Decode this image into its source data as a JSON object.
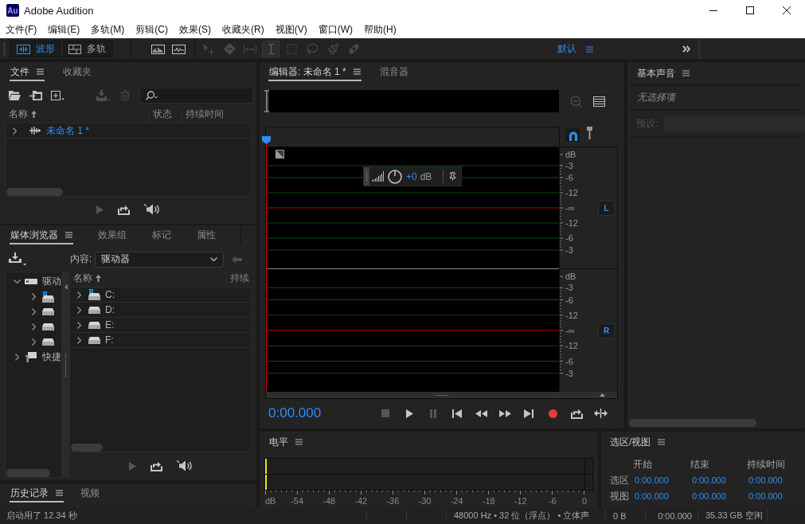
{
  "window": {
    "app_icon": "Au",
    "title": "Adobe Audition"
  },
  "menu": [
    "文件(F)",
    "编辑(E)",
    "多轨(M)",
    "剪辑(C)",
    "效果(S)",
    "收藏夹(R)",
    "视图(V)",
    "窗口(W)",
    "帮助(H)"
  ],
  "toolbar": {
    "views": [
      {
        "kind": "waveform",
        "label": "波形",
        "selected": true
      },
      {
        "kind": "multitrack",
        "label": "多轨",
        "selected": false
      }
    ],
    "displays": [
      {
        "kind": "spectral"
      },
      {
        "kind": "pitch"
      }
    ],
    "tools": [
      {
        "kind": "move",
        "disabled": true,
        "selected": false
      },
      {
        "kind": "razor",
        "disabled": true,
        "selected": false
      },
      {
        "kind": "slip",
        "disabled": true,
        "selected": false
      },
      {
        "kind": "time",
        "disabled": true,
        "selected": true
      },
      {
        "kind": "marquee",
        "disabled": true,
        "selected": false
      },
      {
        "kind": "lasso",
        "disabled": true,
        "selected": false
      },
      {
        "kind": "brush",
        "disabled": true,
        "selected": false
      },
      {
        "kind": "heal",
        "disabled": true,
        "selected": false
      }
    ],
    "workspace": "默认"
  },
  "files_panel": {
    "tabs": [
      {
        "label": "文件",
        "selected": true
      },
      {
        "label": "收藏夹",
        "selected": false
      }
    ],
    "actions": [
      {
        "kind": "open",
        "disabled": false
      },
      {
        "kind": "import",
        "disabled": false
      },
      {
        "kind": "new",
        "disabled": false
      },
      {
        "kind": "insert",
        "disabled": true
      },
      {
        "kind": "delete",
        "disabled": true
      }
    ],
    "columns": [
      {
        "label": "名称",
        "sorted": true
      },
      {
        "label": "状态",
        "sorted": false
      },
      {
        "label": "持续时间",
        "sorted": false
      }
    ],
    "rows": [
      {
        "name": "未命名 1 *",
        "expanded": false,
        "open": true
      }
    ],
    "playback": [
      {
        "kind": "play",
        "disabled": true
      },
      {
        "kind": "loop",
        "disabled": false
      },
      {
        "kind": "autoplay",
        "disabled": false
      }
    ]
  },
  "media_browser": {
    "tabs": [
      {
        "label": "媒体浏览器",
        "selected": true
      },
      {
        "label": "效果组",
        "selected": false
      },
      {
        "label": "标记",
        "selected": false
      },
      {
        "label": "属性",
        "selected": false
      }
    ],
    "content_label": "内容:",
    "content_value": "驱动器",
    "tree": [
      {
        "kind": "drives",
        "label": "驱动",
        "expanded": true,
        "children": [
          {
            "kind": "system",
            "expanded": false
          },
          {
            "kind": "drive",
            "expanded": false
          },
          {
            "kind": "drive",
            "expanded": false
          },
          {
            "kind": "drive",
            "expanded": false
          }
        ]
      },
      {
        "kind": "shortcuts",
        "label": "快捷",
        "expanded": false
      }
    ],
    "columns": [
      {
        "label": "名称",
        "sorted": true
      },
      {
        "label": "持续",
        "sorted": false
      }
    ],
    "rows": [
      {
        "kind": "system",
        "label": "C:",
        "expanded": false
      },
      {
        "kind": "drive",
        "label": "D:",
        "expanded": false
      },
      {
        "kind": "drive",
        "label": "E:",
        "expanded": false
      },
      {
        "kind": "drive",
        "label": "F:",
        "expanded": false
      }
    ],
    "playback": [
      {
        "kind": "play",
        "disabled": true
      },
      {
        "kind": "loop",
        "disabled": false
      },
      {
        "kind": "autoplay",
        "disabled": false
      }
    ]
  },
  "history_panel": {
    "tabs": [
      {
        "label": "历史记录",
        "selected": true
      },
      {
        "label": "视频",
        "selected": false
      }
    ]
  },
  "editor": {
    "tabs": [
      {
        "label": "编辑器: 未命名 1 *",
        "selected": true
      },
      {
        "label": "混音器",
        "selected": false
      }
    ],
    "snap": true,
    "hud": {
      "value": "+0",
      "unit": "dB"
    },
    "channels": [
      {
        "label": "L",
        "enabled": true,
        "scale": [
          "dB",
          "-3",
          "-6",
          "-12",
          "-∞",
          "-12",
          "-6",
          "-3"
        ]
      },
      {
        "label": "R",
        "enabled": true,
        "scale": [
          "dB",
          "-3",
          "-6",
          "-12",
          "-∞",
          "-12",
          "-6",
          "-3"
        ]
      }
    ],
    "time": "0:00.000",
    "transport": [
      {
        "kind": "stop",
        "disabled": true
      },
      {
        "kind": "play",
        "disabled": false
      },
      {
        "kind": "pause",
        "disabled": true
      },
      {
        "kind": "to_start",
        "disabled": false
      },
      {
        "kind": "rewind",
        "disabled": false
      },
      {
        "kind": "forward",
        "disabled": false
      },
      {
        "kind": "to_end",
        "disabled": false
      },
      {
        "kind": "record",
        "disabled": false
      },
      {
        "kind": "loop",
        "disabled": false
      },
      {
        "kind": "skip",
        "disabled": false
      }
    ]
  },
  "levels": {
    "title": "电平",
    "meters": [
      {
        "level": 0
      },
      {
        "level": 0
      }
    ],
    "scale": [
      "dB",
      "-54",
      "-48",
      "-42",
      "-36",
      "-30",
      "-24",
      "-18",
      "-12",
      "-6",
      "0"
    ]
  },
  "essential_sound": {
    "title": "基本声音",
    "message": "无选择项",
    "preset": {
      "label": "预设:",
      "disabled": true
    }
  },
  "selection_view": {
    "title": "选区/视图",
    "columns": [
      "开始",
      "结束",
      "持续时间"
    ],
    "rows": [
      {
        "label": "选区",
        "values": [
          "0:00.000",
          "0:00.000",
          "0:00.000"
        ]
      },
      {
        "label": "视图",
        "values": [
          "0:00.000",
          "0:00.000",
          "0:00.000"
        ]
      }
    ]
  },
  "status_bar": {
    "message": "启动用了 12.34 秒",
    "format": "48000 Hz • 32 位（浮点） • 立体声",
    "size": "0 B",
    "duration": "0:00.000",
    "free": "35.33 GB 空闲"
  }
}
